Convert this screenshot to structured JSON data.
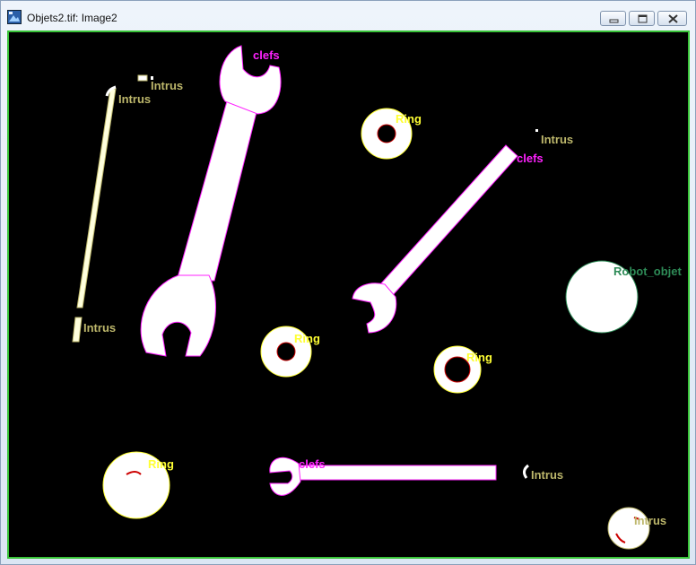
{
  "window": {
    "title": "Objets2.tif: Image2",
    "controls": {
      "minimize": "minimize",
      "restore": "restore",
      "close": "close"
    }
  },
  "colors": {
    "clefs": "#ff22ff",
    "ring": "#ffff33",
    "intrus": "#bdb76b",
    "robot": "#2e8b57",
    "object_fill": "#ffffff",
    "background": "#000000",
    "frame": "#39c439"
  },
  "labels": {
    "clefs_1": "clefs",
    "clefs_2": "clefs",
    "clefs_3": "clefs",
    "ring_1": "Ring",
    "ring_2": "Ring",
    "ring_3": "Ring",
    "ring_4": "Ring",
    "intrus_1": "Intrus",
    "intrus_2": "Intrus",
    "intrus_3": "Intrus",
    "intrus_4": "Intrus",
    "intrus_5": "Intrus",
    "intrus_6": "Intrus",
    "robot": "Robot_objet"
  }
}
